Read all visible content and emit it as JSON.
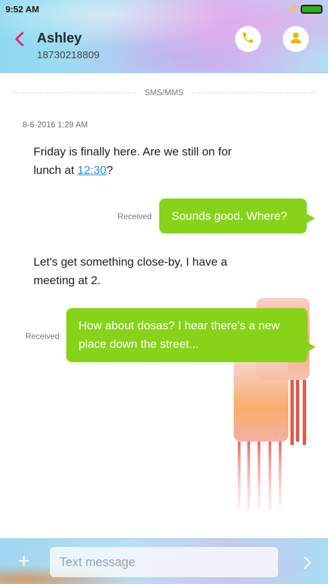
{
  "status_bar": {
    "time": "9:52 AM"
  },
  "header": {
    "contact_name": "Ashley",
    "contact_number": "18730218809"
  },
  "thread": {
    "channel_label": "SMS/MMS",
    "timestamp": "8-6-2016 1:29 AM",
    "messages": [
      {
        "direction": "incoming",
        "text_before_link": "Friday is finally here. Are we still on for lunch at ",
        "link": "12:30",
        "text_after_link": "?"
      },
      {
        "direction": "outgoing",
        "text": "Sounds good. Where?",
        "status": "Received"
      },
      {
        "direction": "incoming",
        "text": "Let's get something close-by, I have a meeting at 2."
      },
      {
        "direction": "outgoing",
        "text": "How about dosas? I hear there's a new place down the street...",
        "status": "Received"
      }
    ]
  },
  "composer": {
    "placeholder": "Text message",
    "value": ""
  },
  "colors": {
    "accent": "#e5206a",
    "bubble": "#86d31a",
    "link": "#1e8be6",
    "icon_yellow": "#f1b400"
  }
}
